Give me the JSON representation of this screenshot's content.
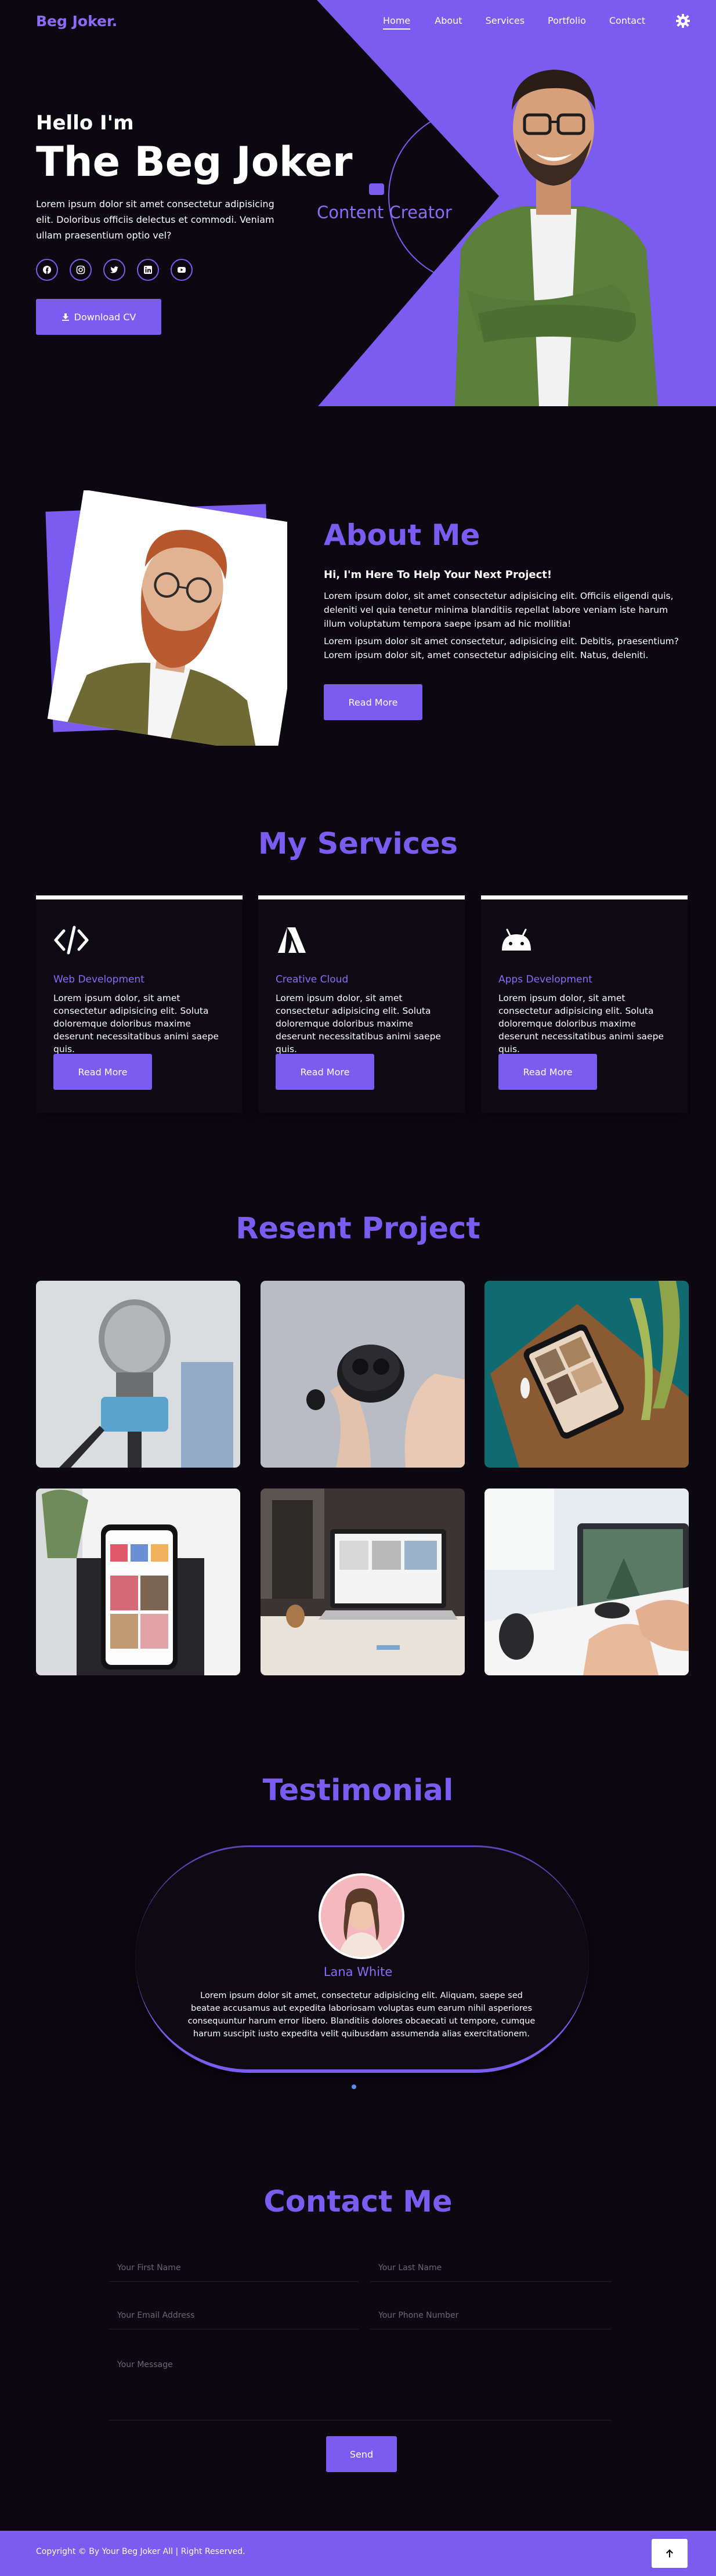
{
  "brand": {
    "logo": "Beg Joker."
  },
  "nav": {
    "items": [
      {
        "label": "Home",
        "active": true
      },
      {
        "label": "About",
        "active": false
      },
      {
        "label": "Services",
        "active": false
      },
      {
        "label": "Portfolio",
        "active": false
      },
      {
        "label": "Contact",
        "active": false
      }
    ],
    "settings_icon": "gear-icon"
  },
  "hero": {
    "greeting": "Hello I'm",
    "name": "The Beg Joker",
    "description": "Lorem ipsum dolor sit amet consectetur adipisicing elit. Doloribus officiis delectus et commodi. Veniam ullam praesentium optio vel?",
    "role": "Content Creator",
    "socials": [
      "facebook-icon",
      "instagram-icon",
      "twitter-icon",
      "linkedin-icon",
      "youtube-icon"
    ],
    "download_label": "Download CV"
  },
  "about": {
    "title": "About Me",
    "subtitle": "Hi, I'm Here To Help Your Next Project!",
    "p1": "Lorem ipsum dolor, sit amet consectetur adipisicing elit. Officiis eligendi quis, deleniti vel quia tenetur minima blanditiis repellat labore veniam iste harum illum voluptatum tempora saepe ipsam ad hic mollitia!",
    "p2": "Lorem ipsum dolor sit amet consectetur, adipisicing elit. Debitis, praesentium? Lorem ipsum dolor sit, amet consectetur adipisicing elit. Natus, deleniti.",
    "button": "Read More"
  },
  "services": {
    "title": "My Services",
    "items": [
      {
        "icon": "code-icon",
        "title": "Web Development",
        "desc": "Lorem ipsum dolor, sit amet consectetur adipisicing elit. Soluta doloremque doloribus maxime deserunt necessitatibus animi saepe quis.",
        "button": "Read More"
      },
      {
        "icon": "adobe-icon",
        "title": "Creative Cloud",
        "desc": "Lorem ipsum dolor, sit amet consectetur adipisicing elit. Soluta doloremque doloribus maxime deserunt necessitatibus animi saepe quis.",
        "button": "Read More"
      },
      {
        "icon": "android-icon",
        "title": "Apps Development",
        "desc": "Lorem ipsum dolor, sit amet consectetur adipisicing elit. Soluta doloremque doloribus maxime deserunt necessitatibus animi saepe quis.",
        "button": "Read More"
      }
    ]
  },
  "projects": {
    "title": "Resent Project",
    "items": [
      {
        "image": "microphone-photo"
      },
      {
        "image": "earbuds-photo"
      },
      {
        "image": "phone-on-table-photo"
      },
      {
        "image": "phone-stand-photo"
      },
      {
        "image": "laptop-desk-photo"
      },
      {
        "image": "gaming-controller-photo"
      }
    ]
  },
  "testimonial": {
    "title": "Testimonial",
    "name": "Lana White",
    "text": "Lorem ipsum dolor sit amet, consectetur adipisicing elit. Aliquam, saepe sed beatae accusamus aut expedita laboriosam voluptas eum earum nihil asperiores consequuntur harum error libero. Blanditiis dolores obcaecati ut tempore, cumque harum suscipit iusto expedita velit quibusdam assumenda alias exercitationem."
  },
  "contact": {
    "title": "Contact Me",
    "first_name_placeholder": "Your First Name",
    "last_name_placeholder": "Your Last Name",
    "email_placeholder": "Your Email Address",
    "phone_placeholder": "Your Phone Number",
    "message_placeholder": "Your Message",
    "send_label": "Send"
  },
  "footer": {
    "text": "Copyright © By Your Beg Joker All | Right Reserved.",
    "top_icon": "arrow-up-icon"
  },
  "colors": {
    "accent": "#7b5cf0",
    "background": "#0c0812",
    "text": "#ffffff"
  }
}
